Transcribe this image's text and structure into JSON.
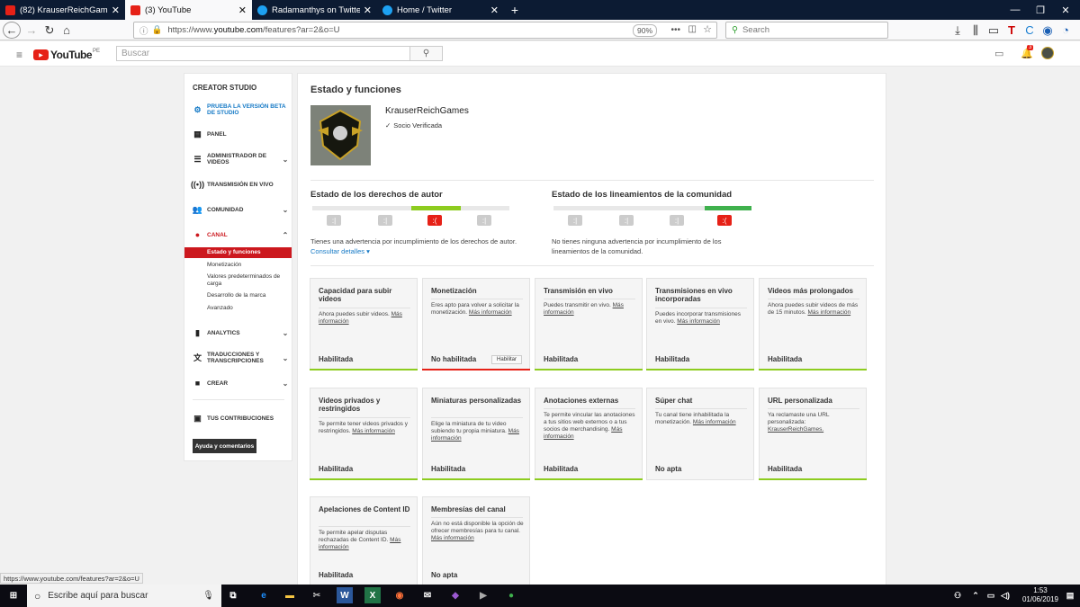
{
  "browser": {
    "tabs": [
      {
        "title": "(82) KrauserReichGames - YouT",
        "favicon_color": "#e62117"
      },
      {
        "title": "(3) YouTube",
        "favicon_color": "#e62117"
      },
      {
        "title": "Radamanthys on Twitter: \"@Te",
        "favicon_color": "#1da1f2"
      },
      {
        "title": "Home / Twitter",
        "favicon_color": "#1da1f2"
      }
    ],
    "new_tab": "+",
    "url_prefix": "https://www.",
    "url_host": "youtube.com",
    "url_path": "/features?ar=2&o=U",
    "zoom": "90%",
    "search_placeholder": "Search",
    "status_url": "https://www.youtube.com/features?ar=2&o=U"
  },
  "yt": {
    "logo_text": "YouTube",
    "region": "PE",
    "search_placeholder": "Buscar",
    "notif_count": "3"
  },
  "sidebar": {
    "header": "CREATOR STUDIO",
    "beta": "PRUEBA LA VERSIÓN BETA DE STUDIO",
    "items": [
      {
        "label": "PANEL",
        "icon": "dashboard-icon"
      },
      {
        "label": "ADMINISTRADOR DE VIDEOS",
        "icon": "video-manager-icon"
      },
      {
        "label": "TRANSMISIÓN EN VIVO",
        "icon": "live-icon"
      },
      {
        "label": "COMUNIDAD",
        "icon": "community-icon"
      },
      {
        "label": "CANAL",
        "icon": "channel-icon"
      },
      {
        "label": "ANALYTICS",
        "icon": "analytics-icon"
      },
      {
        "label": "TRADUCCIONES Y TRANSCRIPCIONES",
        "icon": "translate-icon"
      },
      {
        "label": "CREAR",
        "icon": "create-icon"
      },
      {
        "label": "TUS CONTRIBUCIONES",
        "icon": "contributions-icon"
      }
    ],
    "canal_sub": [
      "Estado y funciones",
      "Monetización",
      "Valores predeterminados de carga",
      "Desarrollo de la marca",
      "Avanzado"
    ],
    "help": "Ayuda y comentarios"
  },
  "main": {
    "title": "Estado y funciones",
    "channel_name": "KrauserReichGames",
    "verified": "Socio Verificada",
    "copyright_title": "Estado de los derechos de autor",
    "copyright_text": "Tienes una advertencia por incumplimiento de los derechos de autor.",
    "copyright_link": "Consultar detalles",
    "community_title": "Estado de los lineamientos de la comunidad",
    "community_text_1": "No tienes ninguna advertencia por incumplimiento de los",
    "community_text_2": "lineamientos de la comunidad.",
    "copyright_level": 3,
    "community_level": 4,
    "features": [
      {
        "title": "Capacidad para subir videos",
        "desc": "Ahora puedes subir videos.",
        "link": "Más información",
        "status": "Habilitada",
        "state": "ok"
      },
      {
        "title": "Monetización",
        "desc": "Eres apto para volver a solicitar la monetización.",
        "link": "Más información",
        "status": "No habilitada",
        "state": "bad",
        "button": "Habilitar"
      },
      {
        "title": "Transmisión en vivo",
        "desc": "Puedes transmitir en vivo.",
        "link": "Más información",
        "status": "Habilitada",
        "state": "ok"
      },
      {
        "title": "Transmisiones en vivo incorporadas",
        "desc": "Puedes incorporar transmisiones en vivo.",
        "link": "Más información",
        "status": "Habilitada",
        "state": "ok"
      },
      {
        "title": "Videos más prolongados",
        "desc": "Ahora puedes subir videos de más de 15 minutos.",
        "link": "Más información",
        "status": "Habilitada",
        "state": "ok"
      },
      {
        "title": "Videos privados y restringidos",
        "desc": "Te permite tener videos privados y restringidos.",
        "link": "Más información",
        "status": "Habilitada",
        "state": "ok"
      },
      {
        "title": "Miniaturas personalizadas",
        "desc": "Elige la miniatura de tu video subiendo tu propia miniatura.",
        "link": "Más información",
        "status": "Habilitada",
        "state": "ok"
      },
      {
        "title": "Anotaciones externas",
        "desc": "Te permite vincular las anotaciones a tus sitios web externos o a tus socios de merchandising.",
        "link": "Más información",
        "status": "Habilitada",
        "state": "ok"
      },
      {
        "title": "Súper chat",
        "desc": "Tu canal tiene inhabilitada la monetización.",
        "link": "Más información",
        "status": "No apta",
        "state": "none"
      },
      {
        "title": "URL personalizada",
        "desc": "Ya reclamaste una URL personalizada:",
        "link": "KrauserReichGames.",
        "status": "Habilitada",
        "state": "ok"
      },
      {
        "title": "Apelaciones de Content ID",
        "desc": "Te permite apelar disputas rechazadas de Content ID.",
        "link": "Más información",
        "status": "Habilitada",
        "state": "ok"
      },
      {
        "title": "Membresías del canal",
        "desc": "Aún no está disponible la opción de ofrecer membresías para tu canal.",
        "link": "Más información",
        "status": "No apta",
        "state": "none"
      }
    ]
  },
  "taskbar": {
    "search": "Escribe aquí para buscar",
    "time": "1:53",
    "date": "01/06/2019"
  },
  "colors": {
    "ok": "#8dcc1f",
    "bad": "#e62117",
    "red": "#cc181e",
    "link": "#167ac6"
  }
}
